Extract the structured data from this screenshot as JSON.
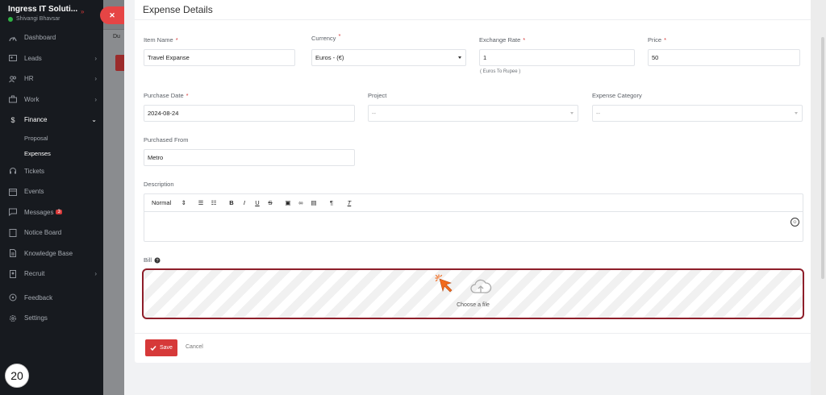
{
  "sidebar": {
    "company": "Ingress IT Soluti...",
    "user": "Shivangi Bhavsar",
    "items": [
      {
        "label": "Dashboard",
        "icon": "dashboard-icon"
      },
      {
        "label": "Leads",
        "icon": "leads-icon"
      },
      {
        "label": "HR",
        "icon": "hr-icon"
      },
      {
        "label": "Work",
        "icon": "work-icon"
      },
      {
        "label": "Finance",
        "icon": "dollar-icon"
      },
      {
        "label": "Tickets",
        "icon": "headset-icon"
      },
      {
        "label": "Events",
        "icon": "calendar-icon"
      },
      {
        "label": "Messages",
        "icon": "message-icon",
        "badge": "3"
      },
      {
        "label": "Notice Board",
        "icon": "notice-icon"
      },
      {
        "label": "Knowledge Base",
        "icon": "knowledge-icon"
      },
      {
        "label": "Recruit",
        "icon": "recruit-icon"
      },
      {
        "label": "Feedback",
        "icon": "feedback-icon"
      },
      {
        "label": "Settings",
        "icon": "settings-icon"
      }
    ],
    "finance_sub": [
      "Proposal",
      "Expenses"
    ],
    "step_number": "20"
  },
  "underlay": {
    "tab_label": "Du"
  },
  "modal": {
    "title": "Expense Details",
    "item_name": {
      "label": "Item Name",
      "value": "Travel Expanse"
    },
    "currency": {
      "label": "Currency",
      "value": "Euros - (€)"
    },
    "exchange_rate": {
      "label": "Exchange Rate",
      "value": "1",
      "hint": "( Euros To Rupee )"
    },
    "price": {
      "label": "Price",
      "value": "50"
    },
    "purchase_date": {
      "label": "Purchase Date",
      "value": "2024-08-24"
    },
    "project": {
      "label": "Project",
      "value": "--"
    },
    "expense_category": {
      "label": "Expense Category",
      "value": "--"
    },
    "purchased_from": {
      "label": "Purchased From",
      "value": "Metro"
    },
    "description": {
      "label": "Description",
      "format_value": "Normal"
    },
    "bill": {
      "label": "Bill",
      "dropzone_text": "Choose a file"
    },
    "save_label": "Save",
    "cancel_label": "Cancel"
  },
  "colors": {
    "accent": "#d63939",
    "sidebar_bg": "#171a1f",
    "dropzone_border": "#8e1e2a"
  }
}
